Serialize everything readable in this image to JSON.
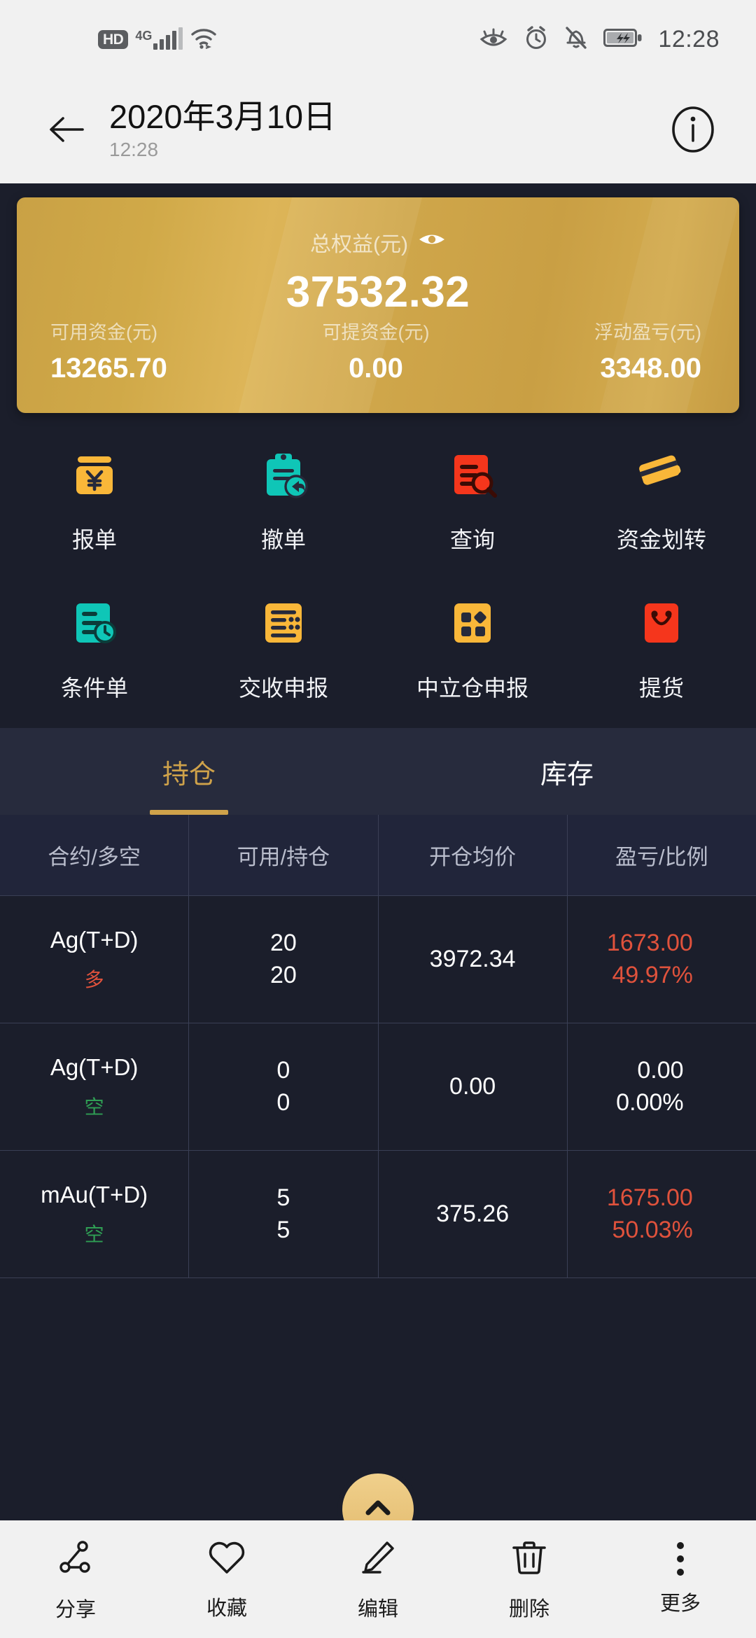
{
  "statusbar": {
    "hd_badge": "HD",
    "network_type": "4G",
    "icons": [
      "hd-badge",
      "signal-icon",
      "wifi-icon",
      "eye-care-icon",
      "alarm-icon",
      "mute-icon",
      "battery-charging-icon"
    ],
    "time": "12:28"
  },
  "header": {
    "back_icon": "back-arrow-icon",
    "title": "2020年3月10日",
    "subtitle": "12:28",
    "info_icon": "info-icon"
  },
  "balance_card": {
    "total_label": "总权益(元)",
    "visibility_icon": "eye-icon",
    "total_value": "37532.32",
    "accent_color": "#cfa24a",
    "stats": [
      {
        "label": "可用资金(元)",
        "value": "13265.70"
      },
      {
        "label": "可提资金(元)",
        "value": "0.00"
      },
      {
        "label": "浮动盈亏(元)",
        "value": "3348.00"
      }
    ]
  },
  "shortcuts": {
    "rows": [
      [
        {
          "label": "报单",
          "icon": "order-yuan-icon",
          "color": "#f9b739"
        },
        {
          "label": "撤单",
          "icon": "cancel-order-clipboard-icon",
          "color": "#0fc6b7"
        },
        {
          "label": "查询",
          "icon": "query-search-doc-icon",
          "color": "#f5361c"
        },
        {
          "label": "资金划转",
          "icon": "fund-transfer-cards-icon",
          "color": "#f9b739"
        }
      ],
      [
        {
          "label": "条件单",
          "icon": "conditional-order-clock-icon",
          "color": "#0fc6b7"
        },
        {
          "label": "交收申报",
          "icon": "delivery-declaration-list-icon",
          "color": "#f9b739"
        },
        {
          "label": "中立仓申报",
          "icon": "neutral-position-grid-icon",
          "color": "#f9b739"
        },
        {
          "label": "提货",
          "icon": "pickup-bag-icon",
          "color": "#f5361c"
        }
      ]
    ]
  },
  "tabs": [
    {
      "label": "持仓",
      "active": true
    },
    {
      "label": "库存",
      "active": false
    }
  ],
  "positions_table": {
    "headers": [
      "合约/多空",
      "可用/持仓",
      "开仓均价",
      "盈亏/比例"
    ],
    "rows": [
      {
        "contract": "Ag(T+D)",
        "side": "多",
        "side_type": "long",
        "available": "20",
        "position": "20",
        "avg_price": "3972.34",
        "pnl": "1673.00",
        "pnl_ratio": "49.97%",
        "pnl_state": "up"
      },
      {
        "contract": "Ag(T+D)",
        "side": "空",
        "side_type": "short",
        "available": "0",
        "position": "0",
        "avg_price": "0.00",
        "pnl": "0.00",
        "pnl_ratio": "0.00%",
        "pnl_state": "flat"
      },
      {
        "contract": "mAu(T+D)",
        "side": "空",
        "side_type": "short",
        "available": "5",
        "position": "5",
        "avg_price": "375.26",
        "pnl": "1675.00",
        "pnl_ratio": "50.03%",
        "pnl_state": "up"
      }
    ]
  },
  "fab": {
    "icon": "chevron-up-icon"
  },
  "bottombar": {
    "items": [
      {
        "label": "分享",
        "icon": "share-icon"
      },
      {
        "label": "收藏",
        "icon": "heart-icon"
      },
      {
        "label": "编辑",
        "icon": "pencil-icon"
      },
      {
        "label": "删除",
        "icon": "trash-icon"
      },
      {
        "label": "更多",
        "icon": "more-dots-icon"
      }
    ]
  }
}
